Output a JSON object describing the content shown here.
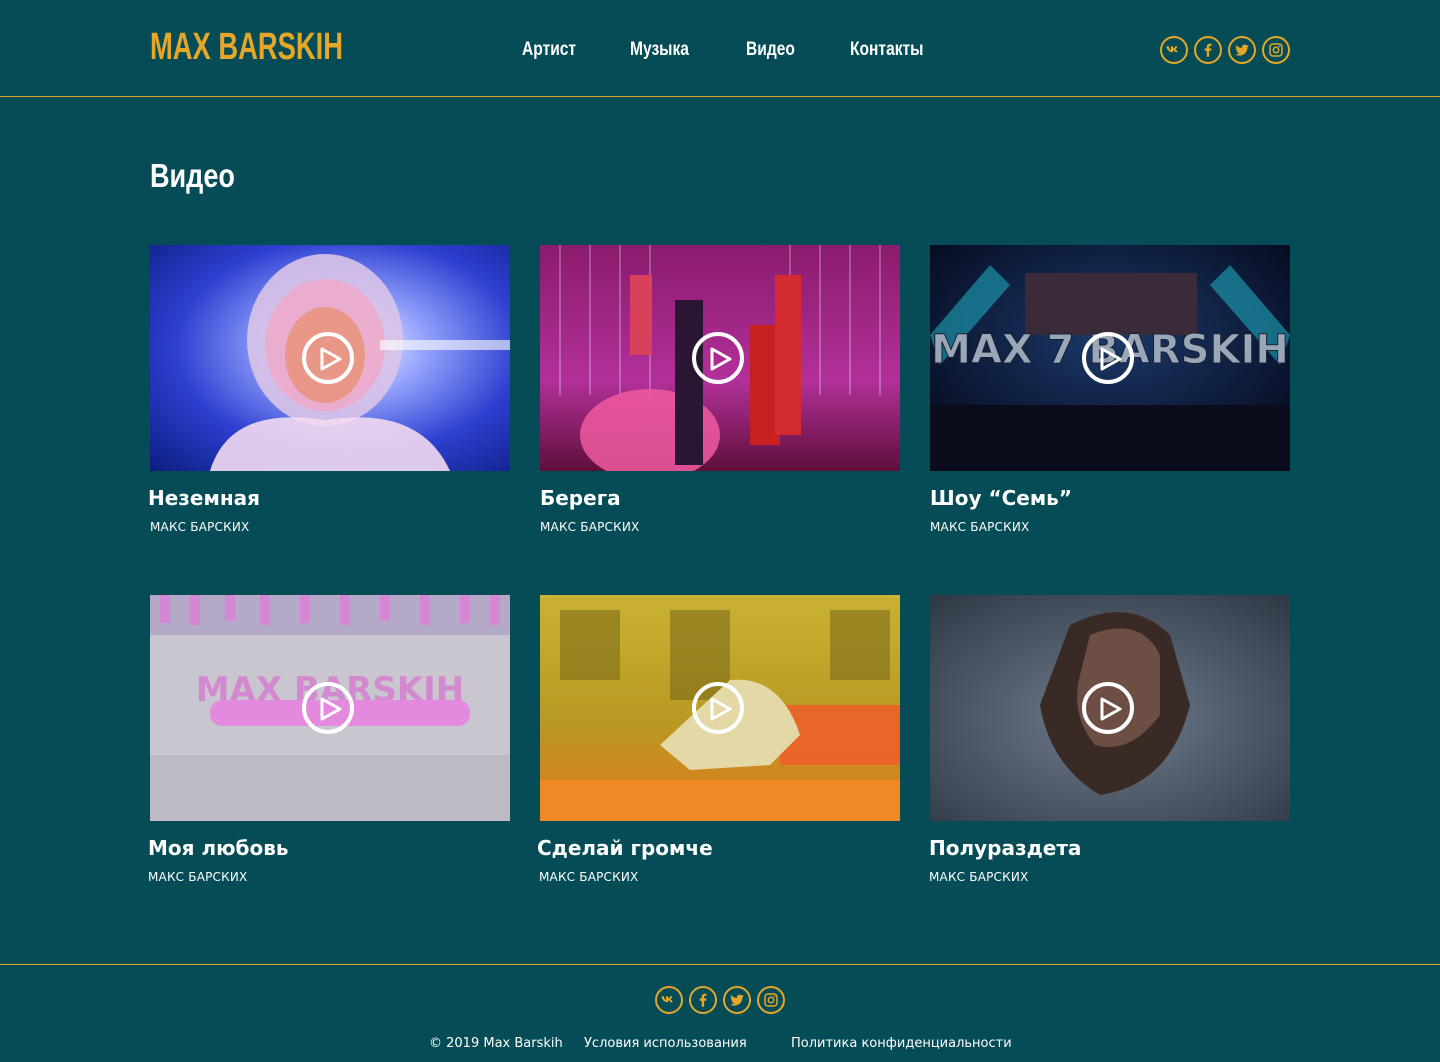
{
  "brand": {
    "logo": "MAX BARSKIH",
    "accent": "#e6a729",
    "background": "#054c56"
  },
  "nav": {
    "items": [
      "Артист",
      "Музыка",
      "Видео",
      "Контакты"
    ]
  },
  "social": [
    "vk-icon",
    "facebook-icon",
    "twitter-icon",
    "instagram-icon"
  ],
  "main": {
    "title": "Видео",
    "videos": [
      {
        "title": "Неземная",
        "artist": "МАКС БАРСКИХ"
      },
      {
        "title": "Берега",
        "artist": "МАКС БАРСКИХ"
      },
      {
        "title": "Шоу “Семь”",
        "artist": "МАКС БАРСКИХ",
        "thumb_text": "MAX 7 BARSKIH"
      },
      {
        "title": "Моя любовь",
        "artist": "МАКС БАРСКИХ",
        "thumb_text": "MAX BARSKIH"
      },
      {
        "title": "Сделай громче",
        "artist": "МАКС БАРСКИХ"
      },
      {
        "title": "Полураздета",
        "artist": "МАКС БАРСКИХ"
      }
    ]
  },
  "footer": {
    "copyright": "© 2019 Max Barskih",
    "terms": "Условия использования",
    "privacy": "Политика конфиденциальности"
  }
}
